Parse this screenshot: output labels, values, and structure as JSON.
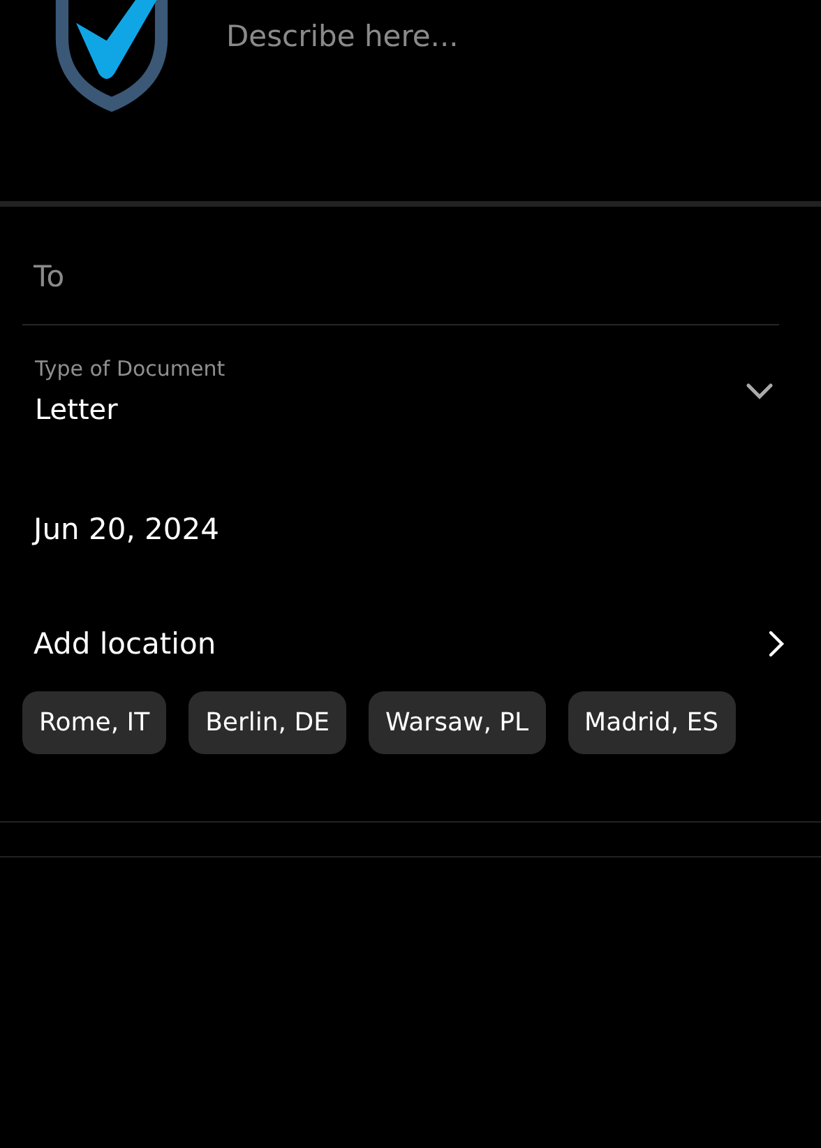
{
  "description": {
    "placeholder": "Describe here..."
  },
  "to": {
    "placeholder": "To"
  },
  "document_type": {
    "label": "Type of Document",
    "value": "Letter"
  },
  "date": "Jun 20, 2024",
  "location": {
    "label": "Add location"
  },
  "suggestions": [
    {
      "label": "Rome, IT"
    },
    {
      "label": "Berlin, DE"
    },
    {
      "label": "Warsaw, PL"
    },
    {
      "label": "Madrid, ES"
    }
  ]
}
